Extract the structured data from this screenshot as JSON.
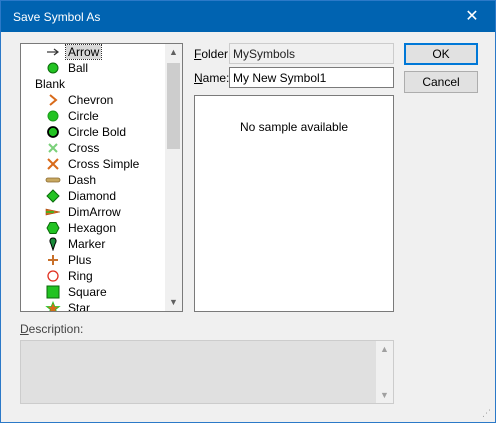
{
  "window": {
    "title": "Save Symbol As",
    "close_glyph": "✕"
  },
  "symbols": [
    {
      "label": "Arrow",
      "icon": "arrow-icon",
      "selected": true
    },
    {
      "label": "Ball",
      "icon": "ball-icon"
    },
    {
      "label": "Blank",
      "icon": ""
    },
    {
      "label": "Chevron",
      "icon": "chevron-icon"
    },
    {
      "label": "Circle",
      "icon": "circle-icon"
    },
    {
      "label": "Circle Bold",
      "icon": "circle-bold-icon"
    },
    {
      "label": "Cross",
      "icon": "cross-icon"
    },
    {
      "label": "Cross Simple",
      "icon": "cross-simple-icon"
    },
    {
      "label": "Dash",
      "icon": "dash-icon"
    },
    {
      "label": "Diamond",
      "icon": "diamond-icon"
    },
    {
      "label": "DimArrow",
      "icon": "dimarrow-icon"
    },
    {
      "label": "Hexagon",
      "icon": "hexagon-icon"
    },
    {
      "label": "Marker",
      "icon": "marker-icon"
    },
    {
      "label": "Plus",
      "icon": "plus-icon"
    },
    {
      "label": "Ring",
      "icon": "ring-icon"
    },
    {
      "label": "Square",
      "icon": "square-icon"
    },
    {
      "label": "Star",
      "icon": "star-icon"
    }
  ],
  "folder": {
    "label_accel": "F",
    "label_rest": "older:",
    "value": "MySymbols"
  },
  "name": {
    "label_accel": "N",
    "label_rest": "ame:",
    "value": "My New Symbol1"
  },
  "preview": {
    "message": "No sample available"
  },
  "buttons": {
    "ok": "OK",
    "cancel": "Cancel"
  },
  "description": {
    "label_accel": "D",
    "label_rest": "escription:",
    "value": ""
  },
  "colors": {
    "titlebar": "#0063b1",
    "green": "#22c322",
    "orange": "#d86a1a",
    "dash": "#c8a860"
  }
}
